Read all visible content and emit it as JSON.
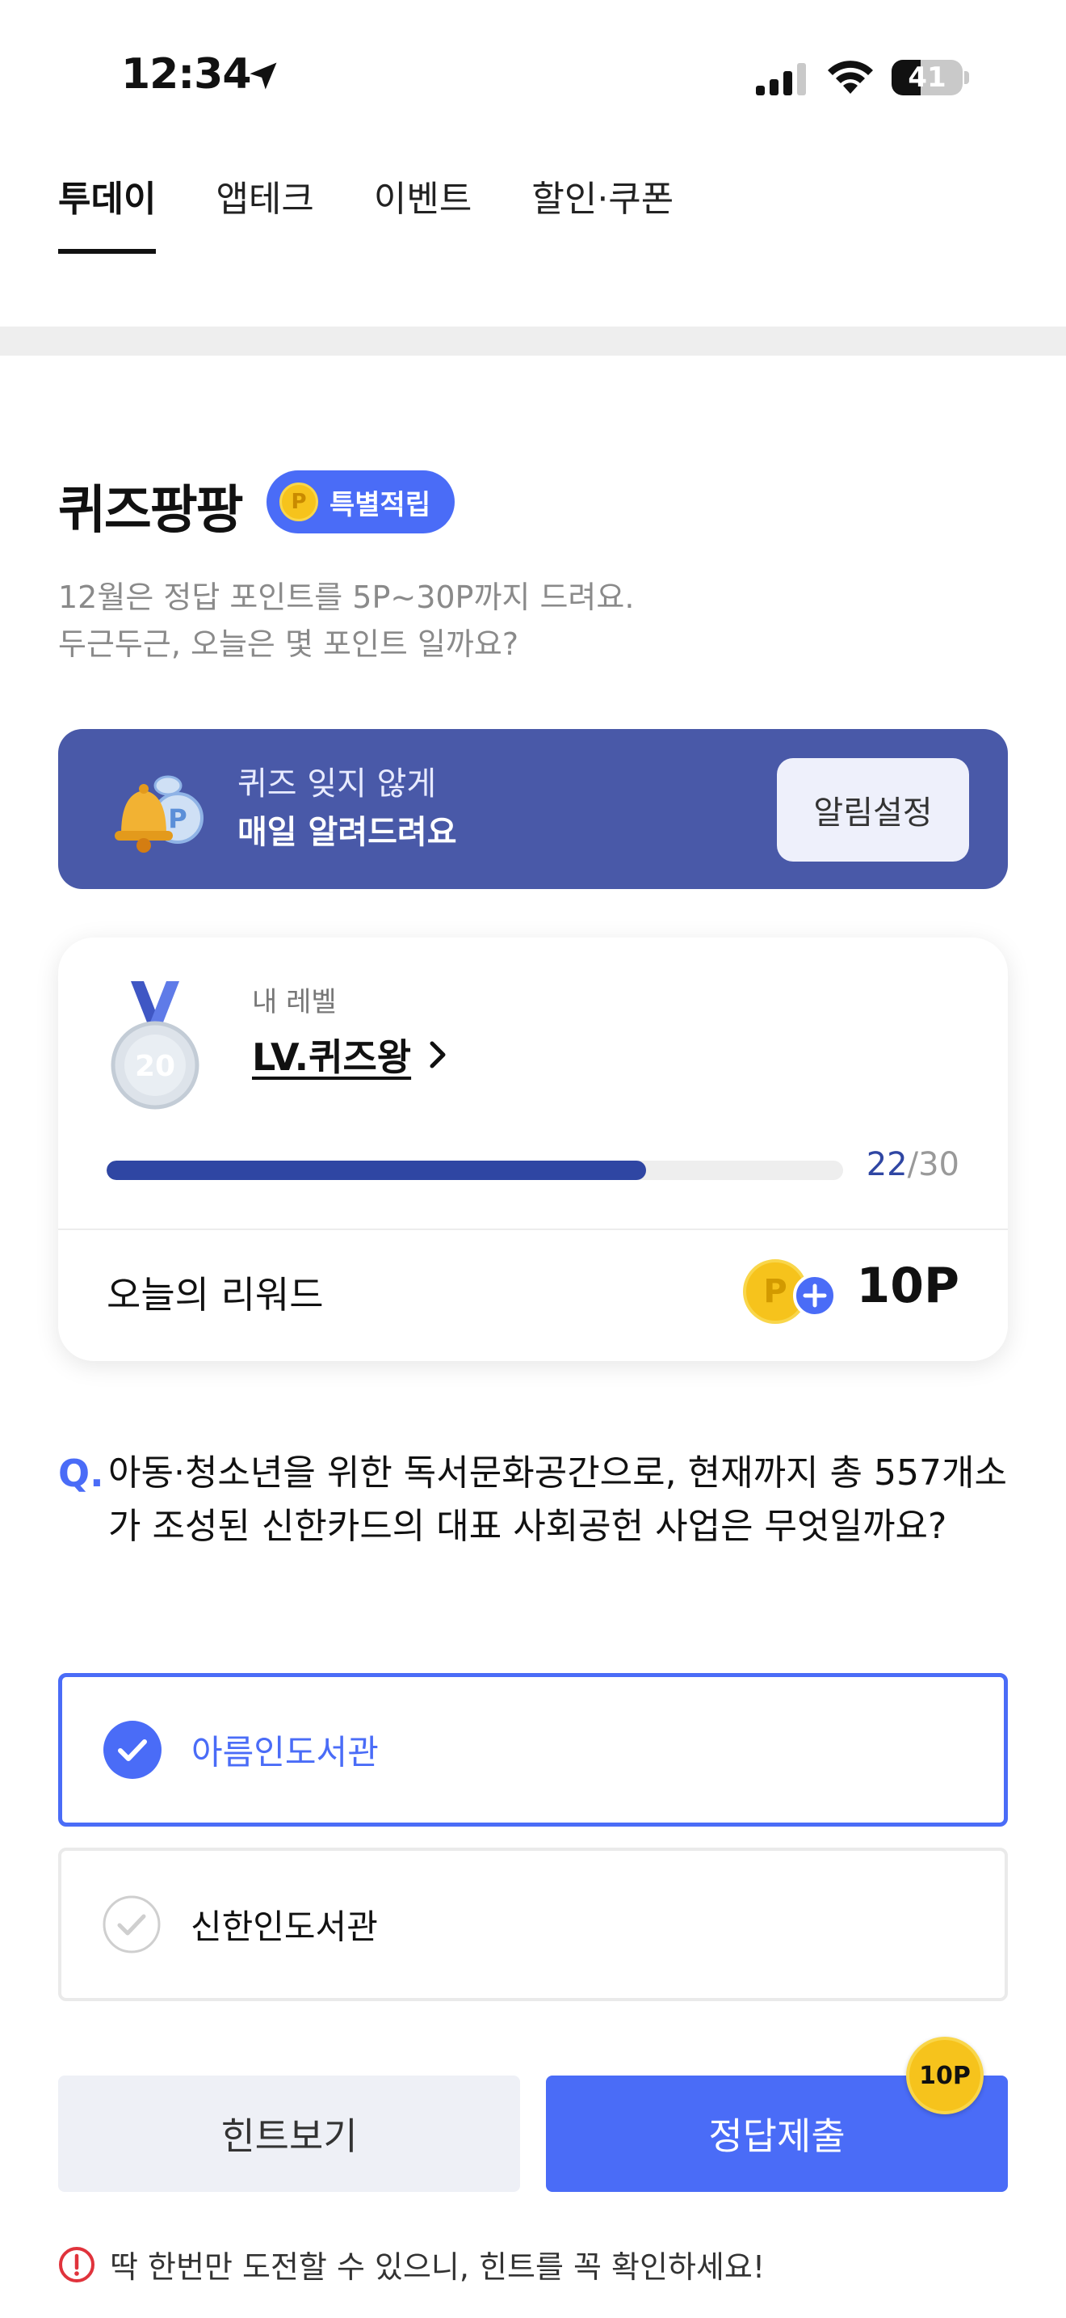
{
  "status_bar": {
    "time": "12:34",
    "battery": "41",
    "battery_level": 0.41
  },
  "tabs": [
    {
      "label": "투데이",
      "active": true
    },
    {
      "label": "앱테크",
      "active": false
    },
    {
      "label": "이벤트",
      "active": false
    },
    {
      "label": "할인·쿠폰",
      "active": false
    }
  ],
  "quiz": {
    "title": "퀴즈팡팡",
    "badge_label": "특별적립",
    "badge_coin_glyph": "P",
    "desc_line1": "12월은 정답 포인트를 5P~30P까지 드려요.",
    "desc_line2": "두근두근, 오늘은 몇 포인트 일까요?"
  },
  "alarm": {
    "line1": "퀴즈 잊지 않게",
    "line2": "매일 알려드려요",
    "button": "알림설정"
  },
  "level": {
    "caption": "내 레벨",
    "name": "LV.퀴즈왕",
    "medal_number": "20",
    "progress_current": "22",
    "progress_total": "/30",
    "progress_fraction": 0.733,
    "reward_label": "오늘의 리워드",
    "reward_coin_glyph": "P",
    "reward_value": "10P"
  },
  "question": {
    "marker": "Q.",
    "text": "아동·청소년을 위한 독서문화공간으로, 현재까지 총 557개소가 조성된 신한카드의 대표 사회공헌 사업은 무엇일까요?"
  },
  "options": [
    {
      "label": "아름인도서관",
      "selected": true
    },
    {
      "label": "신한인도서관",
      "selected": false
    }
  ],
  "buttons": {
    "hint": "힌트보기",
    "submit": "정답제출",
    "point_badge": "10P"
  },
  "warning": "딱 한번만 도전할 수 있으니, 힌트를 꼭 확인하세요!",
  "colors": {
    "accent": "#4a6cf7",
    "banner": "#4959a8",
    "progress": "#2f46a3",
    "coin": "#f6c31c"
  }
}
